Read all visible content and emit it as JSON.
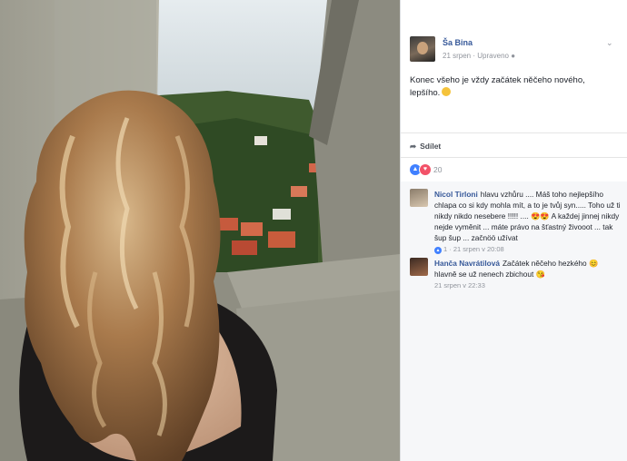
{
  "post": {
    "author": "Ša Bina",
    "date": "21 srpen",
    "separator": "·",
    "edited": "Upraveno",
    "audience_icon": "globe-icon",
    "text": "Konec všeho je vždy začátek něčeho nového, lepšího.",
    "text_emoji": "smile-emoji"
  },
  "actions": {
    "share": "Sdílet",
    "share_icon": "share-arrow-icon"
  },
  "reactions": {
    "count": "20",
    "types": [
      "like-icon",
      "love-icon"
    ]
  },
  "comments": [
    {
      "name": "Nicol Tirloni",
      "text": "hlavu vzhůru .... Máš toho nejlepšího chlapa co si kdy mohla mít, a to je tvůj syn..... Toho už ti nikdy nikdo nesebere !!!!! .... 😍😍 A každej jinnej nikdy nejde vyměnit ... máte právo na šťastný živooot ... tak šup šup ... začnöö užívat",
      "likes": "1",
      "date": "21 srpen v 20:08",
      "separator": "·"
    },
    {
      "name": "Hanča Navrátilová",
      "text": "Začátek něčeho hezkého 😊 hlavně se už nenech zbichout 😘",
      "date": "21 srpen v 22:33"
    }
  ],
  "colors": {
    "link": "#365899",
    "meta": "#90949c",
    "like": "#4080ff",
    "love": "#f25268",
    "background": "#e9ebee"
  }
}
